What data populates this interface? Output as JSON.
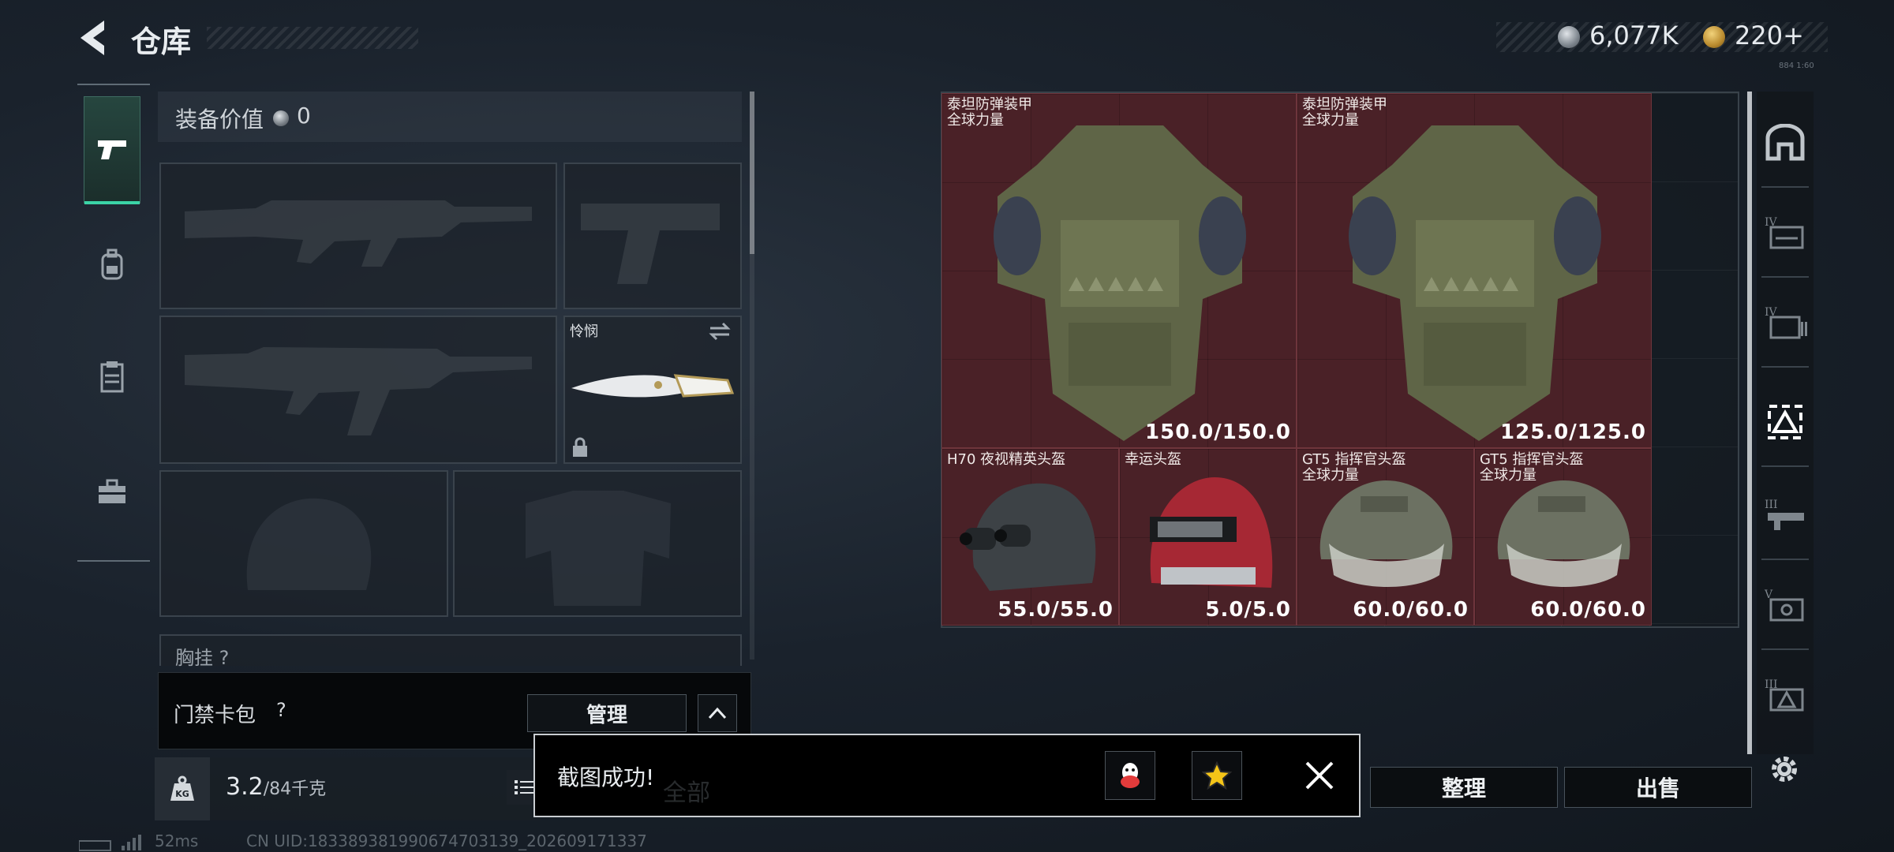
{
  "header": {
    "title": "仓库",
    "currency_1": "6,077K",
    "currency_2": "220+",
    "tiny_text": "884 1:60"
  },
  "loadout": {
    "equip_value_label": "装备价值",
    "equip_value": "0",
    "melee_name": "怜悯",
    "chest_label": "胸挂 ?"
  },
  "keycard": {
    "label": "门禁卡包",
    "help": "?",
    "manage_label": "管理"
  },
  "weight": {
    "current": "3.2",
    "max": "/84千克",
    "ghost_text": "全部"
  },
  "stash": {
    "items": [
      {
        "name": "泰坦防弹装甲",
        "sub": "全球力量",
        "durability": "150.0/150.0"
      },
      {
        "name": "泰坦防弹装甲",
        "sub": "全球力量",
        "durability": "125.0/125.0"
      },
      {
        "name": "H70 夜视精英头盔",
        "sub": "",
        "durability": "55.0/55.0"
      },
      {
        "name": "幸运头盔",
        "sub": "",
        "durability": "5.0/5.0"
      },
      {
        "name": "GT5 指挥官头盔",
        "sub": "全球力量",
        "durability": "60.0/60.0"
      },
      {
        "name": "GT5 指挥官头盔",
        "sub": "全球力量",
        "durability": "60.0/60.0"
      }
    ],
    "rarity_color": "#4a2127"
  },
  "actions": {
    "sort_label": "整理",
    "sell_label": "出售"
  },
  "toast": {
    "text": "截图成功!"
  },
  "footer": {
    "ping": "52ms",
    "uid": "CN UID:18338938199067470313​9_202609171337"
  },
  "right_rail": {
    "tiers": [
      "IV",
      "IV",
      "",
      "III",
      "V",
      "III"
    ]
  },
  "icons": {
    "back": "back-arrow-icon",
    "nav": [
      "pistol-icon",
      "backpack-icon",
      "chest-rig-icon",
      "toolbox-icon"
    ],
    "coin_1": "silver-coin-icon",
    "coin_2": "gold-coin-icon"
  }
}
